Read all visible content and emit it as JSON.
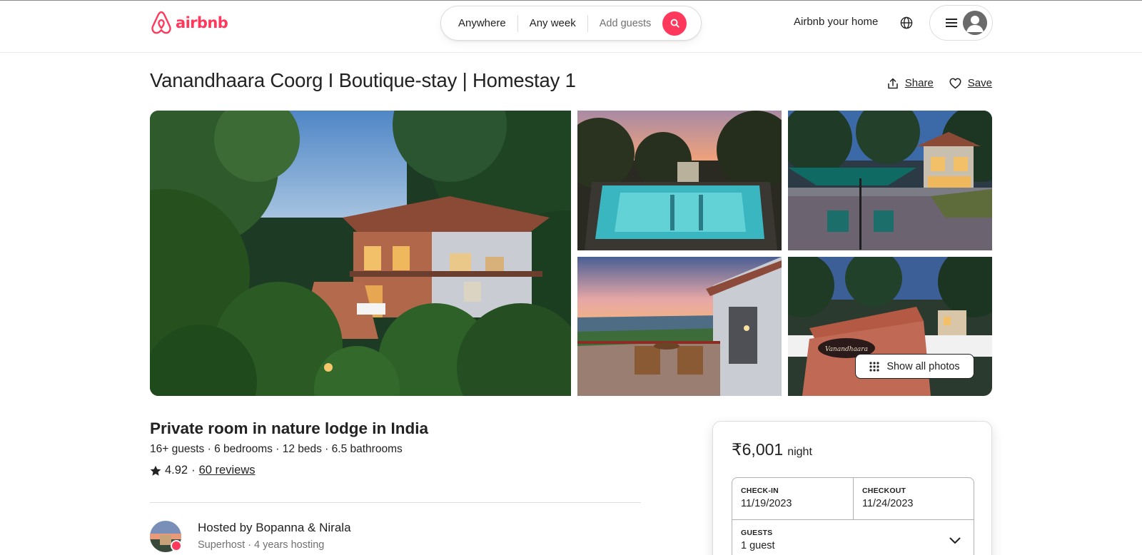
{
  "header": {
    "logo_text": "airbnb",
    "search": {
      "where": "Anywhere",
      "when": "Any week",
      "guests": "Add guests"
    },
    "host_link": "Airbnb your home",
    "brand_color": "#ff385c"
  },
  "listing": {
    "title": "Vanandhaara Coorg I Boutique-stay | Homestay 1",
    "share_label": "Share",
    "save_label": "Save",
    "show_all_photos": "Show all photos",
    "sign_text": "Vanandhaara",
    "room_type": "Private room in nature lodge in India",
    "facts": [
      "16+ guests",
      "6 bedrooms",
      "12 beds",
      "6.5 bathrooms"
    ],
    "rating": "4.92",
    "reviews": "60 reviews",
    "host": {
      "hosted_by": "Hosted by Bopanna & Nirala",
      "details": "Superhost · 4 years hosting"
    }
  },
  "booking": {
    "price": "₹6,001",
    "price_unit": "night",
    "checkin_label": "CHECK-IN",
    "checkin_value": "11/19/2023",
    "checkout_label": "CHECKOUT",
    "checkout_value": "11/24/2023",
    "guests_label": "GUESTS",
    "guests_value": "1 guest"
  },
  "icons": [
    "airbnb-logo-icon",
    "search-icon",
    "globe-icon",
    "menu-icon",
    "user-avatar-icon",
    "share-icon",
    "heart-icon",
    "grid-dots-icon",
    "star-icon",
    "chevron-down-icon"
  ]
}
